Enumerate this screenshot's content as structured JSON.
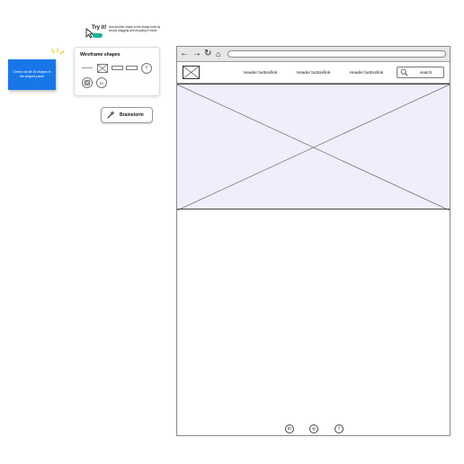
{
  "hint": {
    "title": "Try it!",
    "description": "Add another shape to the shape tools by simply dragging and dropping it inside"
  },
  "note": {
    "text": "Check out all 15 shapes in the shapes panel",
    "color": "#1877e8"
  },
  "shapes_panel": {
    "title": "Wireframe shapes",
    "icons": [
      "line-shape",
      "image-placeholder-shape",
      "input-field-shape",
      "button-shape",
      "facebook-icon",
      "instagram-icon",
      "linkedin-icon"
    ],
    "facebook_glyph": "f",
    "linkedin_glyph": "in"
  },
  "brainstorm": {
    "label": "Brainstorm"
  },
  "wireframe": {
    "nav_links": [
      "Header button/link",
      "Header button/link",
      "Header button/link"
    ],
    "search_placeholder": "search",
    "hero_fill": "#eeeefc",
    "footer_icons": [
      {
        "name": "linkedin-icon",
        "glyph": "in"
      },
      {
        "name": "instagram-icon",
        "glyph": "◎"
      },
      {
        "name": "facebook-icon",
        "glyph": "f"
      }
    ]
  }
}
